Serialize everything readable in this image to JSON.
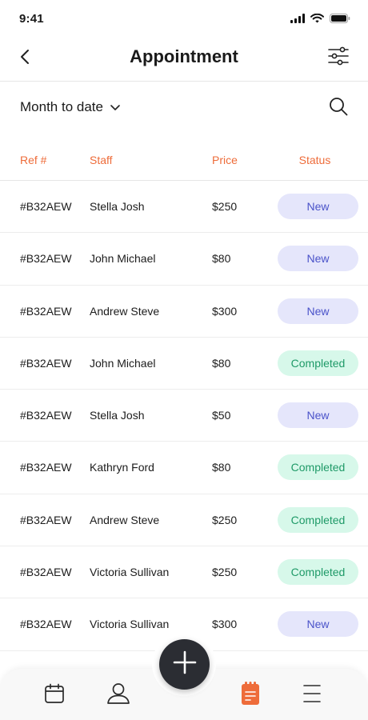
{
  "status_bar": {
    "time": "9:41"
  },
  "header": {
    "title": "Appointment",
    "back_icon": "chevron-left-icon",
    "filter_icon": "sliders-icon"
  },
  "filter": {
    "period_label": "Month to date",
    "dropdown_icon": "chevron-down-icon",
    "search_icon": "search-icon"
  },
  "table": {
    "columns": {
      "ref": "Ref #",
      "staff": "Staff",
      "price": "Price",
      "status": "Status"
    },
    "rows": [
      {
        "ref": "#B32AEW",
        "staff": "Stella Josh",
        "price": "$250",
        "status": "New"
      },
      {
        "ref": "#B32AEW",
        "staff": "John Michael",
        "price": "$80",
        "status": "New"
      },
      {
        "ref": "#B32AEW",
        "staff": "Andrew Steve",
        "price": "$300",
        "status": "New"
      },
      {
        "ref": "#B32AEW",
        "staff": "John Michael",
        "price": "$80",
        "status": "Completed"
      },
      {
        "ref": "#B32AEW",
        "staff": "Stella Josh",
        "price": "$50",
        "status": "New"
      },
      {
        "ref": "#B32AEW",
        "staff": "Kathryn Ford",
        "price": "$80",
        "status": "Completed"
      },
      {
        "ref": "#B32AEW",
        "staff": "Andrew Steve",
        "price": "$250",
        "status": "Completed"
      },
      {
        "ref": "#B32AEW",
        "staff": "Victoria Sullivan",
        "price": "$250",
        "status": "Completed"
      },
      {
        "ref": "#B32AEW",
        "staff": "Victoria Sullivan",
        "price": "$300",
        "status": "New"
      }
    ]
  },
  "bottom_nav": {
    "items": [
      "calendar-icon",
      "profile-icon",
      "clipboard-icon",
      "menu-icon"
    ],
    "active": "clipboard-icon",
    "fab_icon": "plus-icon"
  },
  "colors": {
    "accent": "#ee6c3a",
    "new_badge_bg": "#e5e6fb",
    "new_badge_text": "#4a53c9",
    "completed_badge_bg": "#d7f8ea",
    "completed_badge_text": "#1f9a68",
    "fab": "#2b2d33"
  }
}
